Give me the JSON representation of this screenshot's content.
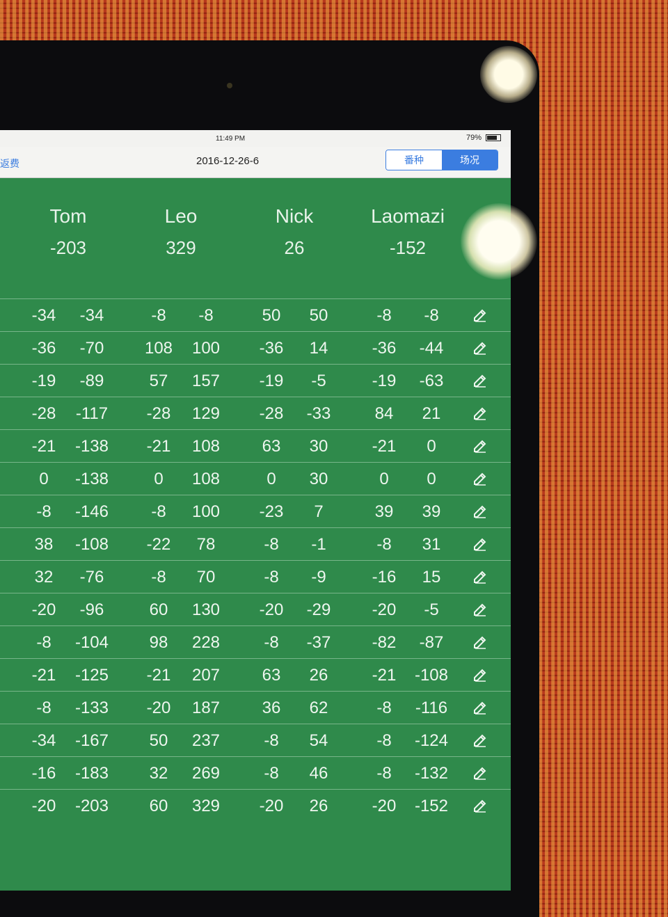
{
  "status": {
    "time": "11:49 PM",
    "battery": "79%"
  },
  "nav": {
    "back_label": "返费",
    "title": "2016-12-26-6",
    "segments": [
      "番种",
      "场况"
    ],
    "active_segment": 1
  },
  "players": [
    {
      "name": "Tom",
      "total": "-203"
    },
    {
      "name": "Leo",
      "total": "329"
    },
    {
      "name": "Nick",
      "total": "26"
    },
    {
      "name": "Laomazi",
      "total": "-152"
    }
  ],
  "rows": [
    [
      "-34",
      "-34",
      "-8",
      "-8",
      "50",
      "50",
      "-8",
      "-8"
    ],
    [
      "-36",
      "-70",
      "108",
      "100",
      "-36",
      "14",
      "-36",
      "-44"
    ],
    [
      "-19",
      "-89",
      "57",
      "157",
      "-19",
      "-5",
      "-19",
      "-63"
    ],
    [
      "-28",
      "-117",
      "-28",
      "129",
      "-28",
      "-33",
      "84",
      "21"
    ],
    [
      "-21",
      "-138",
      "-21",
      "108",
      "63",
      "30",
      "-21",
      "0"
    ],
    [
      "0",
      "-138",
      "0",
      "108",
      "0",
      "30",
      "0",
      "0"
    ],
    [
      "-8",
      "-146",
      "-8",
      "100",
      "-23",
      "7",
      "39",
      "39"
    ],
    [
      "38",
      "-108",
      "-22",
      "78",
      "-8",
      "-1",
      "-8",
      "31"
    ],
    [
      "32",
      "-76",
      "-8",
      "70",
      "-8",
      "-9",
      "-16",
      "15"
    ],
    [
      "-20",
      "-96",
      "60",
      "130",
      "-20",
      "-29",
      "-20",
      "-5"
    ],
    [
      "-8",
      "-104",
      "98",
      "228",
      "-8",
      "-37",
      "-82",
      "-87"
    ],
    [
      "-21",
      "-125",
      "-21",
      "207",
      "63",
      "26",
      "-21",
      "-108"
    ],
    [
      "-8",
      "-133",
      "-20",
      "187",
      "36",
      "62",
      "-8",
      "-116"
    ],
    [
      "-34",
      "-167",
      "50",
      "237",
      "-8",
      "54",
      "-8",
      "-124"
    ],
    [
      "-16",
      "-183",
      "32",
      "269",
      "-8",
      "46",
      "-8",
      "-132"
    ],
    [
      "-20",
      "-203",
      "60",
      "329",
      "-20",
      "26",
      "-20",
      "-152"
    ]
  ],
  "icons": {
    "row_action": "pencil-icon"
  },
  "colors": {
    "screen": "#2f8a4b",
    "accent": "#3b7de0"
  }
}
